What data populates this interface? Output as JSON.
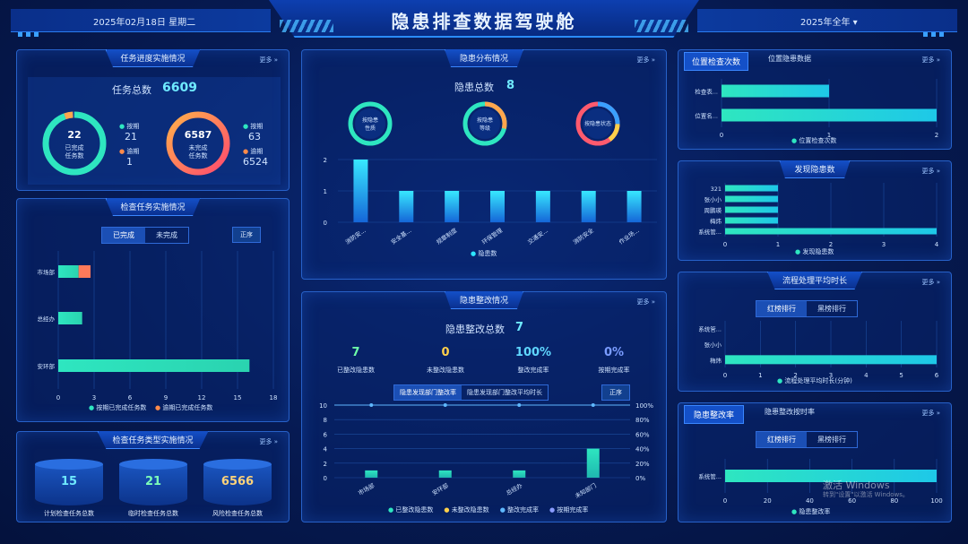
{
  "header": {
    "title": "隐患排查数据驾驶舱",
    "date": "2025年02月18日 星期二",
    "year_select": "2025年全年 ▾"
  },
  "common": {
    "more": "更多 »"
  },
  "task_progress": {
    "title": "任务进度实施情况",
    "total_label": "任务总数",
    "total": "6609",
    "done": {
      "value": "22",
      "label1": "已完成",
      "label2": "任务数",
      "ontime_label": "按期",
      "ontime": "21",
      "overdue_label": "逾期",
      "overdue": "1"
    },
    "undone": {
      "value": "6587",
      "label1": "未完成",
      "label2": "任务数",
      "ontime_label": "按期",
      "ontime": "63",
      "overdue_label": "逾期",
      "overdue": "6524"
    }
  },
  "inspection_tasks": {
    "title": "检查任务实施情况",
    "tab_done": "已完成",
    "tab_undone": "未完成",
    "sort": "正序",
    "legend_ontime": "按期已完成任务数",
    "legend_overdue": "逾期已完成任务数",
    "x_ticks": [
      "0",
      "3",
      "6",
      "9",
      "12",
      "15",
      "18"
    ]
  },
  "task_types": {
    "title": "检查任务类型实施情况",
    "items": [
      {
        "value": "15",
        "label": "计划检查任务总数",
        "color": "#6fe9ff"
      },
      {
        "value": "21",
        "label": "临时检查任务总数",
        "color": "#7dffb8"
      },
      {
        "value": "6566",
        "label": "风险检查任务总数",
        "color": "#ffd37a"
      }
    ]
  },
  "hazard_dist": {
    "title": "隐患分布情况",
    "total_label": "隐患总数",
    "total": "8",
    "rings": [
      {
        "label1": "按隐患",
        "label2": "性质"
      },
      {
        "label1": "按隐患",
        "label2": "等级"
      },
      {
        "label1": "按隐患状态",
        "label2": ""
      }
    ],
    "legend": "隐患数"
  },
  "rectify": {
    "title": "隐患整改情况",
    "total_label": "隐患整改总数",
    "total": "7",
    "stats": [
      {
        "value": "7",
        "label": "已整改隐患数",
        "color": "#6dffa8"
      },
      {
        "value": "0",
        "label": "未整改隐患数",
        "color": "#ffd04a"
      },
      {
        "value": "100%",
        "label": "整改完成率",
        "color": "#5fd6ff"
      },
      {
        "value": "0%",
        "label": "按期完成率",
        "color": "#7a9cff"
      }
    ],
    "tab1": "隐患发现部门整改率",
    "tab2": "隐患发现部门整改平均时长",
    "sort": "正序",
    "legend": [
      "已整改隐患数",
      "未整改隐患数",
      "整改完成率",
      "按期完成率"
    ]
  },
  "location_count": {
    "tab1": "位置检查次数",
    "tab2": "位置隐患数据",
    "legend": "位置检查次数"
  },
  "discovered": {
    "title": "发现隐患数",
    "legend": "发现隐患数"
  },
  "process_time": {
    "title": "流程处理平均时长",
    "tab_red": "红榜排行",
    "tab_black": "黑榜排行",
    "legend": "流程处理平均时长(分钟)"
  },
  "rectify_rate": {
    "tab1": "隐患整改率",
    "tab2": "隐患整改按时率",
    "tab_red": "红榜排行",
    "tab_black": "黑榜排行",
    "legend": "隐患整改率"
  },
  "watermark": {
    "line1": "激活 Windows",
    "line2": "转到\"设置\"以激活 Windows。"
  },
  "chart_data": [
    {
      "type": "bar",
      "id": "inspection",
      "orientation": "horizontal",
      "categories": [
        "市场部",
        "总经办",
        "安环部"
      ],
      "series": [
        {
          "name": "按期已完成任务数",
          "values": [
            1.7,
            2,
            16
          ]
        },
        {
          "name": "逾期已完成任务数",
          "values": [
            1,
            0,
            0
          ]
        }
      ],
      "xlim": [
        0,
        18
      ]
    },
    {
      "type": "bar",
      "id": "distribution",
      "categories": [
        "消防安...",
        "安全基...",
        "规章制度",
        "环保管理",
        "交通安...",
        "消防安全",
        "作业场..."
      ],
      "values": [
        2,
        1,
        1,
        1,
        1,
        1,
        1
      ],
      "ylim": [
        0,
        2
      ],
      "y_ticks": [
        "0",
        "1",
        "2"
      ]
    },
    {
      "type": "bar",
      "id": "rectify",
      "categories": [
        "市场部",
        "安环部",
        "总经办",
        "未知部门"
      ],
      "series": [
        {
          "name": "已整改隐患数",
          "values": [
            1,
            1,
            1,
            4
          ]
        },
        {
          "name": "整改完成率",
          "values": [
            100,
            100,
            100,
            100
          ]
        }
      ],
      "ylim": [
        0,
        10
      ],
      "y2lim": [
        0,
        100
      ],
      "y_ticks": [
        "0",
        "2",
        "4",
        "6",
        "8",
        "10"
      ],
      "y2_ticks": [
        "0%",
        "20%",
        "40%",
        "60%",
        "80%",
        "100%"
      ]
    },
    {
      "type": "bar",
      "id": "location",
      "orientation": "horizontal",
      "categories": [
        "检查表...",
        "位置名..."
      ],
      "values": [
        1,
        2
      ],
      "xlim": [
        0,
        2
      ],
      "x_ticks": [
        "0",
        "1",
        "2"
      ]
    },
    {
      "type": "bar",
      "id": "discovered",
      "orientation": "horizontal",
      "categories": [
        "321",
        "张小小",
        "周鹏瑛",
        "梅炜",
        "系统管..."
      ],
      "values": [
        1,
        1,
        1,
        1,
        4
      ],
      "xlim": [
        0,
        4
      ],
      "x_ticks": [
        "0",
        "1",
        "2",
        "3",
        "4"
      ]
    },
    {
      "type": "bar",
      "id": "process",
      "orientation": "horizontal",
      "categories": [
        "系统管...",
        "张小小",
        "梅炜"
      ],
      "values": [
        0,
        0,
        6
      ],
      "xlim": [
        0,
        6
      ],
      "x_ticks": [
        "0",
        "1",
        "2",
        "3",
        "4",
        "5",
        "6"
      ]
    },
    {
      "type": "bar",
      "id": "rectrate",
      "orientation": "horizontal",
      "categories": [
        "系统管..."
      ],
      "values": [
        100
      ],
      "xlim": [
        0,
        100
      ],
      "x_ticks": [
        "0",
        "20",
        "40",
        "60",
        "80",
        "100"
      ]
    }
  ]
}
